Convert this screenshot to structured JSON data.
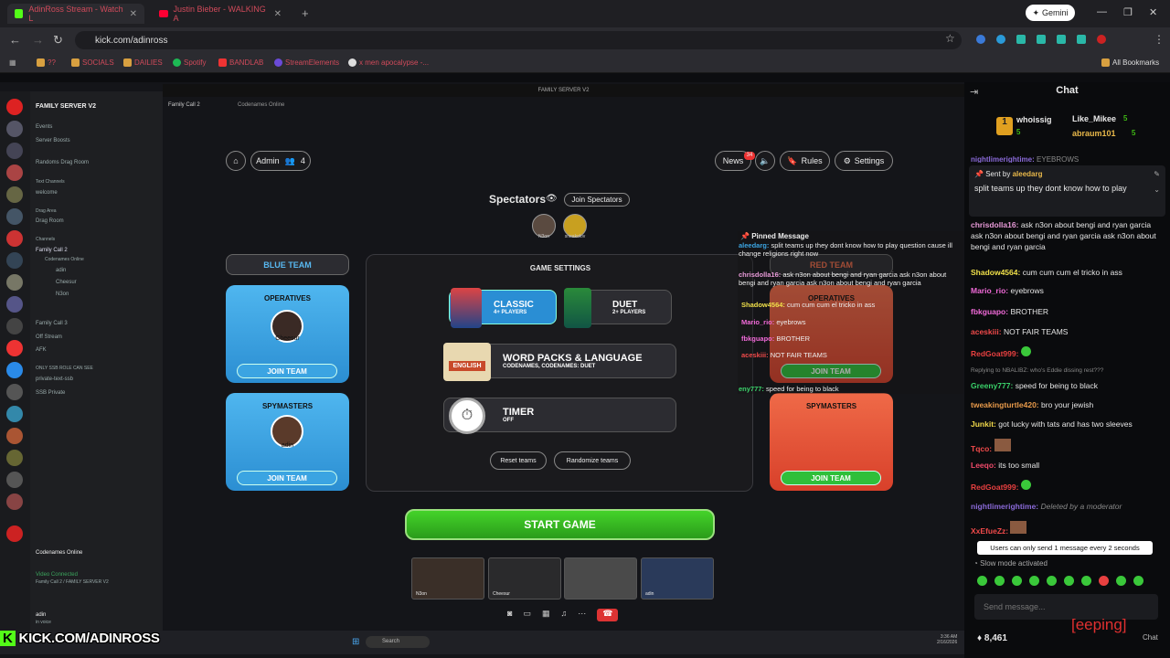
{
  "browser": {
    "tabs": [
      {
        "label": "AdinRoss Stream - Watch L"
      },
      {
        "label": "Justin Bieber - WALKING A"
      }
    ],
    "gemini_label": "Gemini",
    "url": "kick.com/adinross",
    "bookmarks": [
      "??",
      "SOCIALS",
      "DAILIES",
      "Spotify",
      "BANDLAB",
      "StreamElements",
      "x men apocalypse -..."
    ],
    "all_bookmarks": "All Bookmarks"
  },
  "discord": {
    "server_name": "FAMILY SERVER V2",
    "window_title": "FAMILY SERVER V2",
    "channels": [
      "Events",
      "Server Boosts",
      "Randoms Drag Room",
      "Text Channels",
      "welcome",
      "Drag Area",
      "Drag Room",
      "Channels",
      "Family Call 2",
      "Codenames Online",
      "adin",
      "Cheesur",
      "N3on",
      "Family Call 3",
      "Off Stream",
      "AFK",
      "ONLY SSB ROLE CAN SEE",
      "private-text-ssb",
      "SSB Private"
    ],
    "activity_header": "Family Call 2",
    "activity_name": "Codenames Online",
    "voice_status": "Video Connected",
    "voice_channel": "Family Call 2 / FAMILY SERVER V2",
    "user": "adin",
    "user_status": "in voice",
    "taskbar_search": "Search",
    "clock_time": "3:36 AM",
    "clock_date": "2/16/2026"
  },
  "codenames": {
    "admin_label": "Admin",
    "player_count": "4",
    "news_label": "News",
    "news_badge": "34",
    "rules_label": "Rules",
    "settings_label": "Settings",
    "spectators_label": "Spectators",
    "join_spectators": "Join Spectators",
    "spectators": [
      "N3on",
      "sneakolov"
    ],
    "blue_team": {
      "title": "BLUE TEAM",
      "operatives_label": "OPERATIVES",
      "operative": "Cheesur",
      "spymasters_label": "SPYMASTERS",
      "spymaster": "adin",
      "join": "JOIN TEAM"
    },
    "red_team": {
      "title": "RED TEAM",
      "operatives_label": "OPERATIVES",
      "spymasters_label": "SPYMASTERS",
      "join": "JOIN TEAM"
    },
    "game_settings": {
      "title": "GAME SETTINGS",
      "classic": "CLASSIC",
      "classic_sub": "4+ PLAYERS",
      "duet": "DUET",
      "duet_sub": "2+ PLAYERS",
      "word_packs": "WORD PACKS & LANGUAGE",
      "word_packs_sub": "CODENAMES, CODENAMES: DUET",
      "language_badge": "ENGLISH",
      "timer": "TIMER",
      "timer_value": "OFF",
      "reset": "Reset teams",
      "randomize": "Randomize teams"
    },
    "start_game": "START GAME",
    "cams": [
      "N3on",
      "Cheesur",
      "",
      "adin"
    ]
  },
  "overlay_pinned": {
    "title": "Pinned Message",
    "lines": [
      {
        "user": "aleedarg:",
        "text": "split teams up they dont know how to play question cause ill change religions right now"
      },
      {
        "user": "chrisdolla16:",
        "text": "ask n3on about bengi and ryan garcia ask n3on about bengi and ryan garcia ask n3on about bengi and ryan garcia"
      },
      {
        "user": "Shadow4564:",
        "text": "cum cum cum el tricko in ass"
      },
      {
        "user": "Mario_rio:",
        "text": "eyebrows"
      },
      {
        "user": "fbkguapo:",
        "text": "BROTHER"
      },
      {
        "user": "aceskiii:",
        "text": "NOT FAIR TEAMS"
      },
      {
        "user": "eny777:",
        "text": "speed for being to black"
      }
    ]
  },
  "chat": {
    "title": "Chat",
    "leaderboard": [
      {
        "name": "whoissig",
        "count": "5"
      },
      {
        "name": "Like_Mikee",
        "count": "5"
      },
      {
        "name": "abraum101",
        "count": "5"
      }
    ],
    "cut_line": {
      "user": "nightlimerightime:",
      "text": "EYEBROWS"
    },
    "pinned": {
      "sent_by": "Sent by",
      "user": "aleedarg",
      "text": "split teams up they dont know how to play"
    },
    "messages": [
      {
        "user": "chrisdolla16:",
        "color": "#e89ad8",
        "text": "ask n3on about bengi and ryan garcia ask n3on about bengi and ryan garcia ask n3on about bengi and ryan garcia"
      },
      {
        "user": "Shadow4564:",
        "color": "#f0e04a",
        "text": "cum cum cum el tricko in ass"
      },
      {
        "user": "Mario_rio:",
        "color": "#f06ad8",
        "text": "eyebrows"
      },
      {
        "user": "fbkguapo:",
        "color": "#f06ad8",
        "text": "BROTHER"
      },
      {
        "user": "aceskiii:",
        "color": "#f04a4a",
        "text": "NOT FAIR TEAMS"
      },
      {
        "user": "RedGoat999:",
        "color": "#e84040",
        "text": ""
      },
      {
        "user": "",
        "color": "#888888",
        "text": "Replying to NBALIBZ: who's Eddie dissing rest???"
      },
      {
        "user": "Greeny777:",
        "color": "#3ad26a",
        "text": "speed for being to black"
      },
      {
        "user": "tweakingturtle420:",
        "color": "#e89a4a",
        "text": "bro your jewish"
      },
      {
        "user": "Junkit:",
        "color": "#f0d84a",
        "text": "got lucky with tats and has two sleeves"
      },
      {
        "user": "Tqco:",
        "color": "#f04a4a",
        "text": ""
      },
      {
        "user": "Leeqo:",
        "color": "#f04a6a",
        "text": "its too small"
      },
      {
        "user": "RedGoat999:",
        "color": "#e84040",
        "text": ""
      },
      {
        "user": "nightlimerightime:",
        "color": "#8a6ad8",
        "text": "Deleted by a moderator"
      },
      {
        "user": "XxEfueZz:",
        "color": "#f04a4a",
        "text": ""
      }
    ],
    "slow_tooltip": "Users can only send 1 message every 2 seconds",
    "slow_mode": "Slow mode activated",
    "send_placeholder": "Send message...",
    "points": "8,461",
    "watermark": "[eeping]",
    "chat_btn": "Chat"
  },
  "overlay_logo": "KICK.COM/ADINROSS"
}
